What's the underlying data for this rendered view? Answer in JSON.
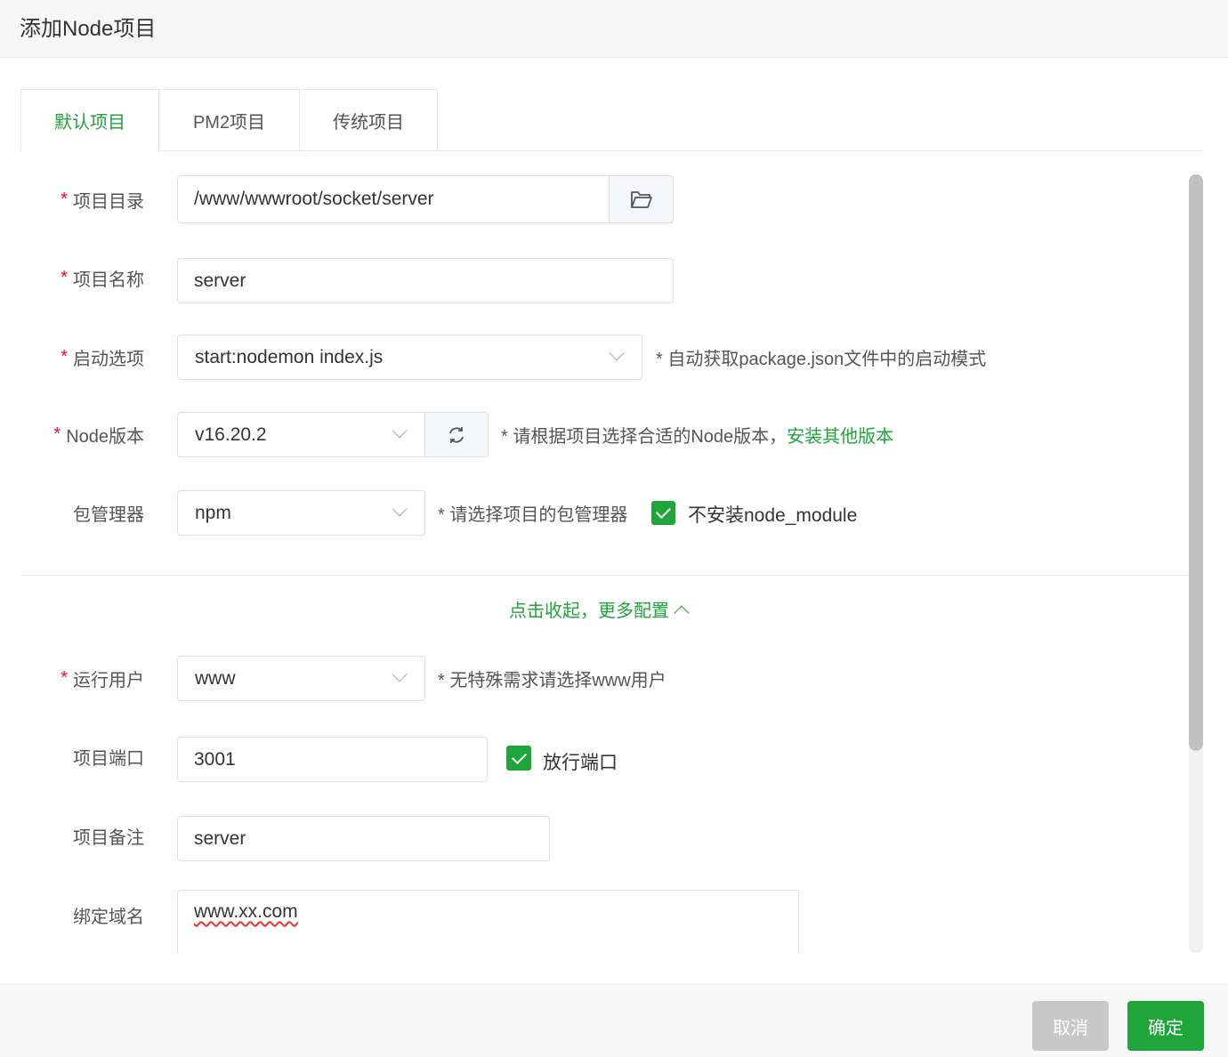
{
  "dialog": {
    "title": "添加Node项目"
  },
  "tabs": [
    {
      "label": "默认项目",
      "active": true
    },
    {
      "label": "PM2项目"
    },
    {
      "label": "传统项目"
    }
  ],
  "form": {
    "project_dir": {
      "label": "项目目录",
      "value": "/www/wwwroot/socket/server"
    },
    "project_name": {
      "label": "项目名称",
      "value": "server"
    },
    "start_option": {
      "label": "启动选项",
      "value": "start:nodemon index.js",
      "hint": "* 自动获取package.json文件中的启动模式"
    },
    "node_version": {
      "label": "Node版本",
      "value": "v16.20.2",
      "hint": "* 请根据项目选择合适的Node版本，",
      "link": "安装其他版本"
    },
    "package_manager": {
      "label": "包管理器",
      "value": "npm",
      "hint": "* 请选择项目的包管理器",
      "checkbox_label": "不安装node_module",
      "checked": true
    },
    "collapse_link": "点击收起，更多配置",
    "run_user": {
      "label": "运行用户",
      "value": "www",
      "hint": "* 无特殊需求请选择www用户"
    },
    "port": {
      "label": "项目端口",
      "value": "3001",
      "checkbox_label": "放行端口",
      "checked": true
    },
    "remark": {
      "label": "项目备注",
      "value": "server"
    },
    "domain": {
      "label": "绑定域名",
      "value": "www.xx.com"
    }
  },
  "footer": {
    "cancel": "取消",
    "confirm": "确定"
  },
  "colors": {
    "accent": "#20a53a",
    "required": "#ff0033"
  }
}
